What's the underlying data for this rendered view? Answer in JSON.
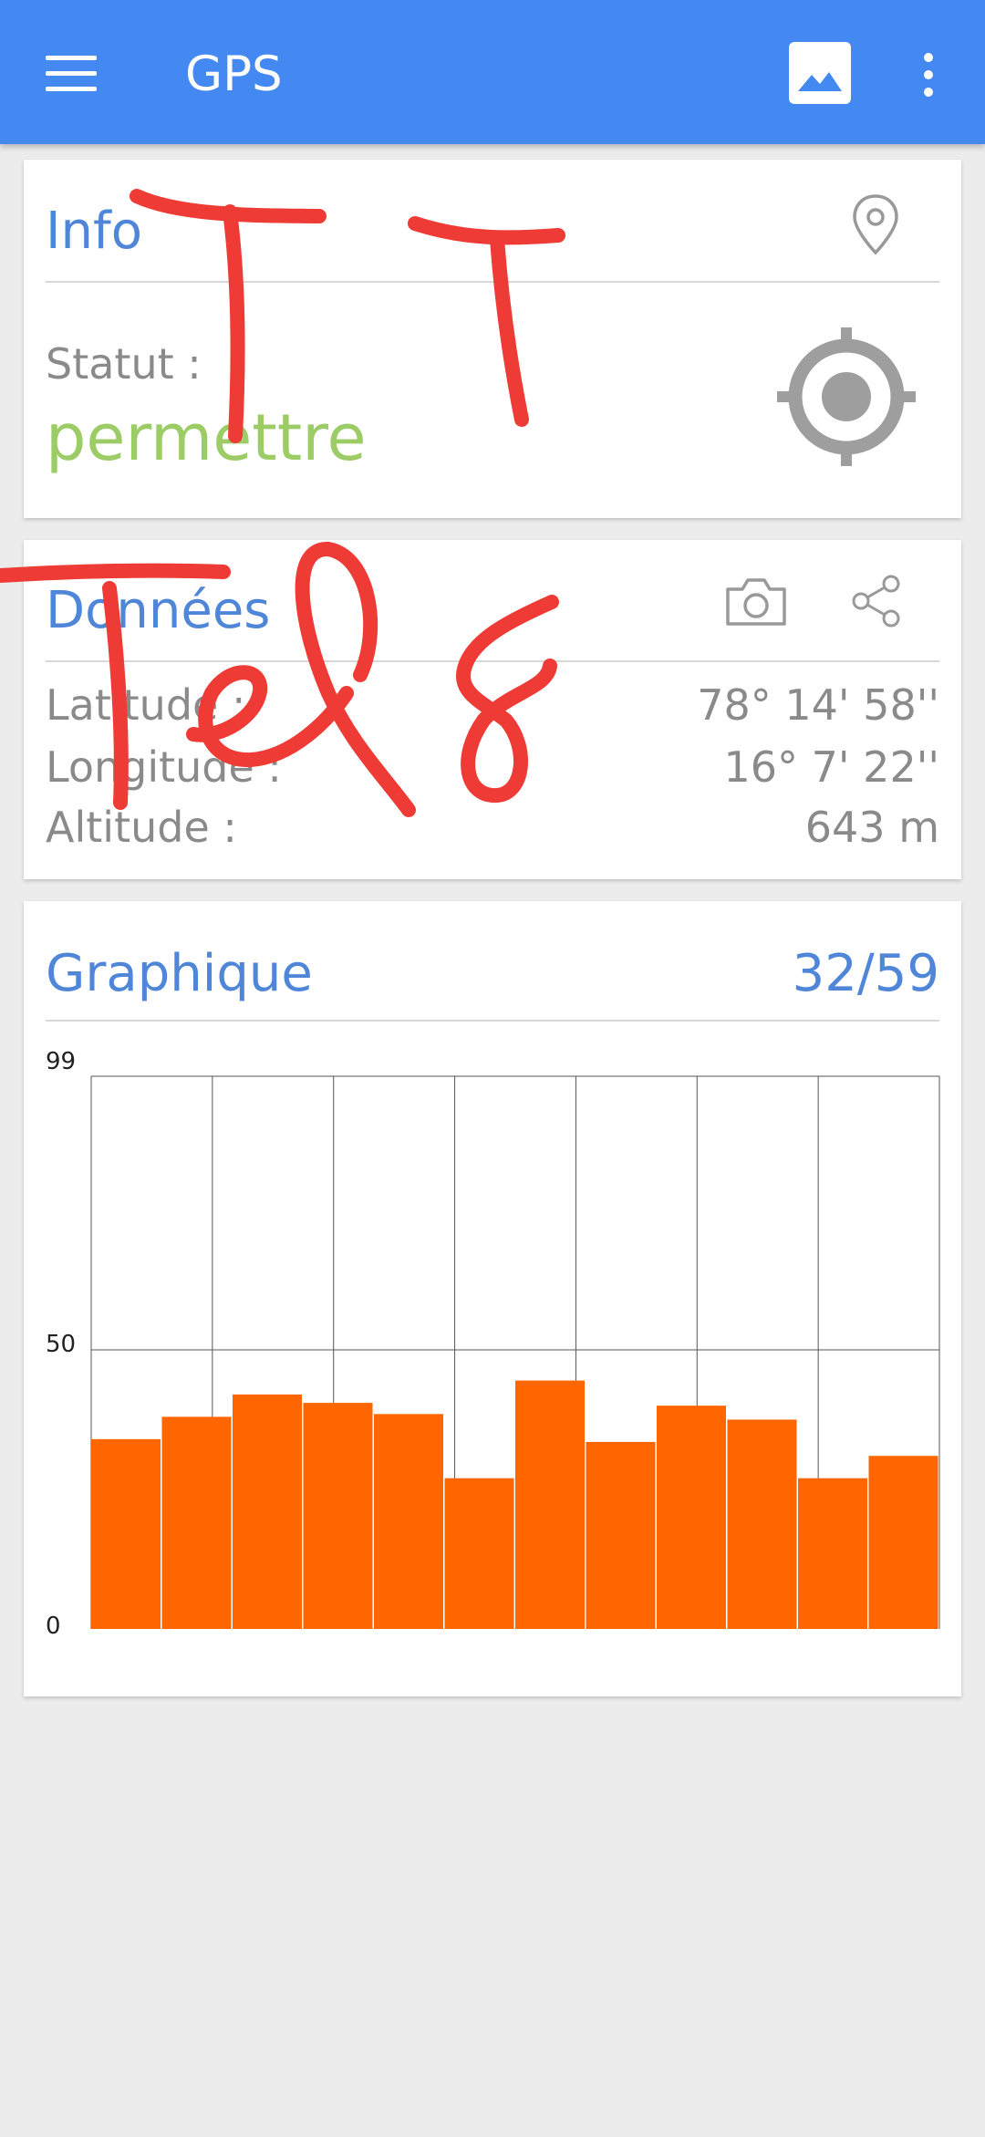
{
  "appbar": {
    "title": "GPS",
    "icons": {
      "menu": "menu-icon",
      "gallery": "image-icon",
      "more": "more-vert-icon"
    }
  },
  "info_card": {
    "title": "Info",
    "status_label": "Statut :",
    "status_value": "permettre",
    "status_color": "#9ccc65",
    "icons": {
      "location": "location-pin-icon",
      "gps": "gps-target-icon"
    }
  },
  "data_card": {
    "title": "Données",
    "rows": [
      {
        "label": "Latitude :",
        "value": "78° 14' 58''"
      },
      {
        "label": "Longitude :",
        "value": "16° 7' 22''"
      },
      {
        "label": "Altitude :",
        "value": "643 m"
      }
    ],
    "icons": {
      "camera": "camera-icon",
      "share": "share-icon"
    }
  },
  "chart_card": {
    "title": "Graphique",
    "counter": "32/59"
  },
  "chart_data": {
    "type": "bar",
    "title": "",
    "xlabel": "",
    "ylabel": "",
    "ylim": [
      0,
      99
    ],
    "yticks": [
      "99",
      "50",
      "0"
    ],
    "bar_color": "#ff6600",
    "grid": true,
    "values": [
      34,
      38,
      42,
      40.5,
      38.5,
      27,
      44.5,
      33.5,
      40,
      37.5,
      27,
      31
    ]
  },
  "colors": {
    "accent": "#4488f2",
    "title_blue": "#4f86d8",
    "ink_red": "#ee3b35"
  }
}
